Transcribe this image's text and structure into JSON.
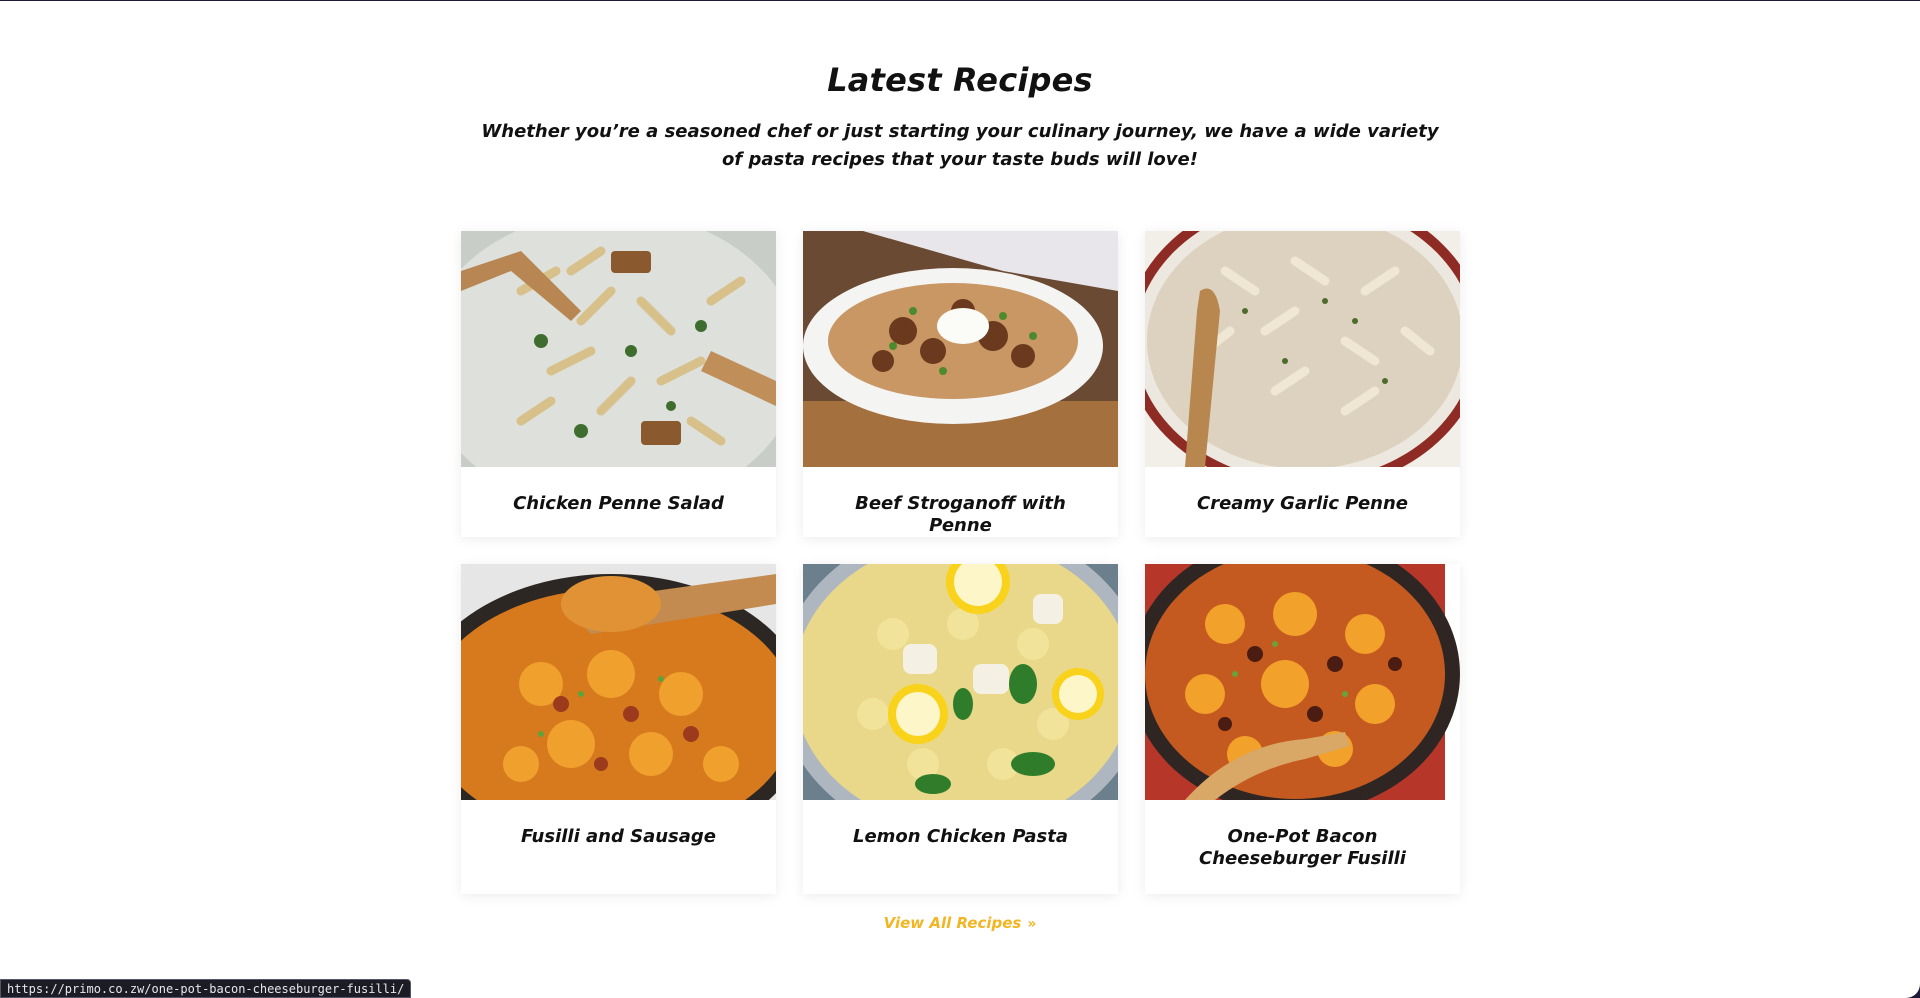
{
  "section": {
    "title": "Latest Recipes",
    "subtitle": "Whether you’re a seasoned chef or just starting your culinary journey, we have a wide variety of pasta recipes that your taste buds will love!"
  },
  "recipes": [
    {
      "title": "Chicken Penne Salad",
      "image": "penne-salad-photo"
    },
    {
      "title": "Beef Stroganoff with Penne",
      "image": "beef-stroganoff-photo"
    },
    {
      "title": "Creamy Garlic Penne",
      "image": "creamy-penne-photo"
    },
    {
      "title": "Fusilli and Sausage",
      "image": "fusilli-sausage-photo"
    },
    {
      "title": "Lemon Chicken Pasta",
      "image": "lemon-chicken-photo"
    },
    {
      "title": "One-Pot Bacon Cheeseburger Fusilli",
      "image": "bacon-cheeseburger-photo"
    }
  ],
  "view_all": {
    "label": "View All Recipes",
    "icon": "double-chevron-right-icon"
  },
  "status_bar": {
    "url": "https://primo.co.zw/one-pot-bacon-cheeseburger-fusilli/"
  },
  "colors": {
    "accent": "#f2b624",
    "text": "#111111",
    "background": "#ffffff"
  }
}
